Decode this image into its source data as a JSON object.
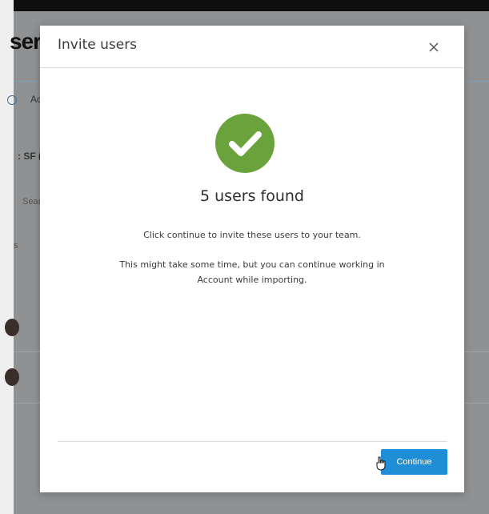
{
  "background": {
    "page_title_partial": "ser",
    "tab_partial": "Ac",
    "filter_partial": ": SF (",
    "search_partial": "Sear",
    "column_partial": "s"
  },
  "modal": {
    "title": "Invite users",
    "close_icon": "close-icon",
    "status_icon": "check-circle-icon",
    "status_color": "#6aa23c",
    "result_title": "5 users found",
    "message_primary": "Click continue to invite these users to your team.",
    "message_secondary": "This might take some time, but you can continue working in Account while importing.",
    "continue_label": "Continue",
    "accent_color": "#1f8ed6"
  }
}
